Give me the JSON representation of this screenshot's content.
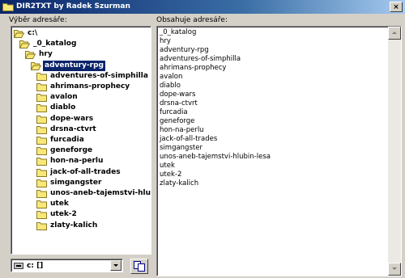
{
  "window": {
    "title": "DIR2TXT by Radek Szurman",
    "close_glyph": "×"
  },
  "labels": {
    "tree": "Výběr adresáře:",
    "content": "Obsahuje adresáře:"
  },
  "tree": {
    "items": [
      {
        "name": "c:\\",
        "depth": 0,
        "open": true,
        "selected": false
      },
      {
        "name": "_0_katalog",
        "depth": 1,
        "open": true,
        "selected": false
      },
      {
        "name": "hry",
        "depth": 2,
        "open": true,
        "selected": false
      },
      {
        "name": "adventury-rpg",
        "depth": 3,
        "open": true,
        "selected": true
      },
      {
        "name": "adventures-of-simphilla",
        "depth": 4,
        "open": false,
        "selected": false
      },
      {
        "name": "ahrimans-prophecy",
        "depth": 4,
        "open": false,
        "selected": false
      },
      {
        "name": "avalon",
        "depth": 4,
        "open": false,
        "selected": false
      },
      {
        "name": "diablo",
        "depth": 4,
        "open": false,
        "selected": false
      },
      {
        "name": "dope-wars",
        "depth": 4,
        "open": false,
        "selected": false
      },
      {
        "name": "drsna-ctvrt",
        "depth": 4,
        "open": false,
        "selected": false
      },
      {
        "name": "furcadia",
        "depth": 4,
        "open": false,
        "selected": false
      },
      {
        "name": "geneforge",
        "depth": 4,
        "open": false,
        "selected": false
      },
      {
        "name": "hon-na-perlu",
        "depth": 4,
        "open": false,
        "selected": false
      },
      {
        "name": "jack-of-all-trades",
        "depth": 4,
        "open": false,
        "selected": false
      },
      {
        "name": "simgangster",
        "depth": 4,
        "open": false,
        "selected": false
      },
      {
        "name": "unos-aneb-tajemstvi-hlubin-lesa",
        "depth": 4,
        "open": false,
        "selected": false
      },
      {
        "name": "utek",
        "depth": 4,
        "open": false,
        "selected": false
      },
      {
        "name": "utek-2",
        "depth": 4,
        "open": false,
        "selected": false
      },
      {
        "name": "zlaty-kalich",
        "depth": 4,
        "open": false,
        "selected": false
      }
    ]
  },
  "drive": {
    "value": "c: []"
  },
  "content": {
    "lines": [
      "_0_katalog",
      "hry",
      "adventury-rpg",
      "adventures-of-simphilla",
      "ahrimans-prophecy",
      "avalon",
      "diablo",
      "dope-wars",
      "drsna-ctvrt",
      "furcadia",
      "geneforge",
      "hon-na-perlu",
      "jack-of-all-trades",
      "simgangster",
      "unos-aneb-tajemstvi-hlubin-lesa",
      "utek",
      "utek-2",
      "zlaty-kalich"
    ]
  },
  "colors": {
    "selection": "#0a246a",
    "folder": "#f8e878",
    "folder_outline": "#8a7a28"
  }
}
